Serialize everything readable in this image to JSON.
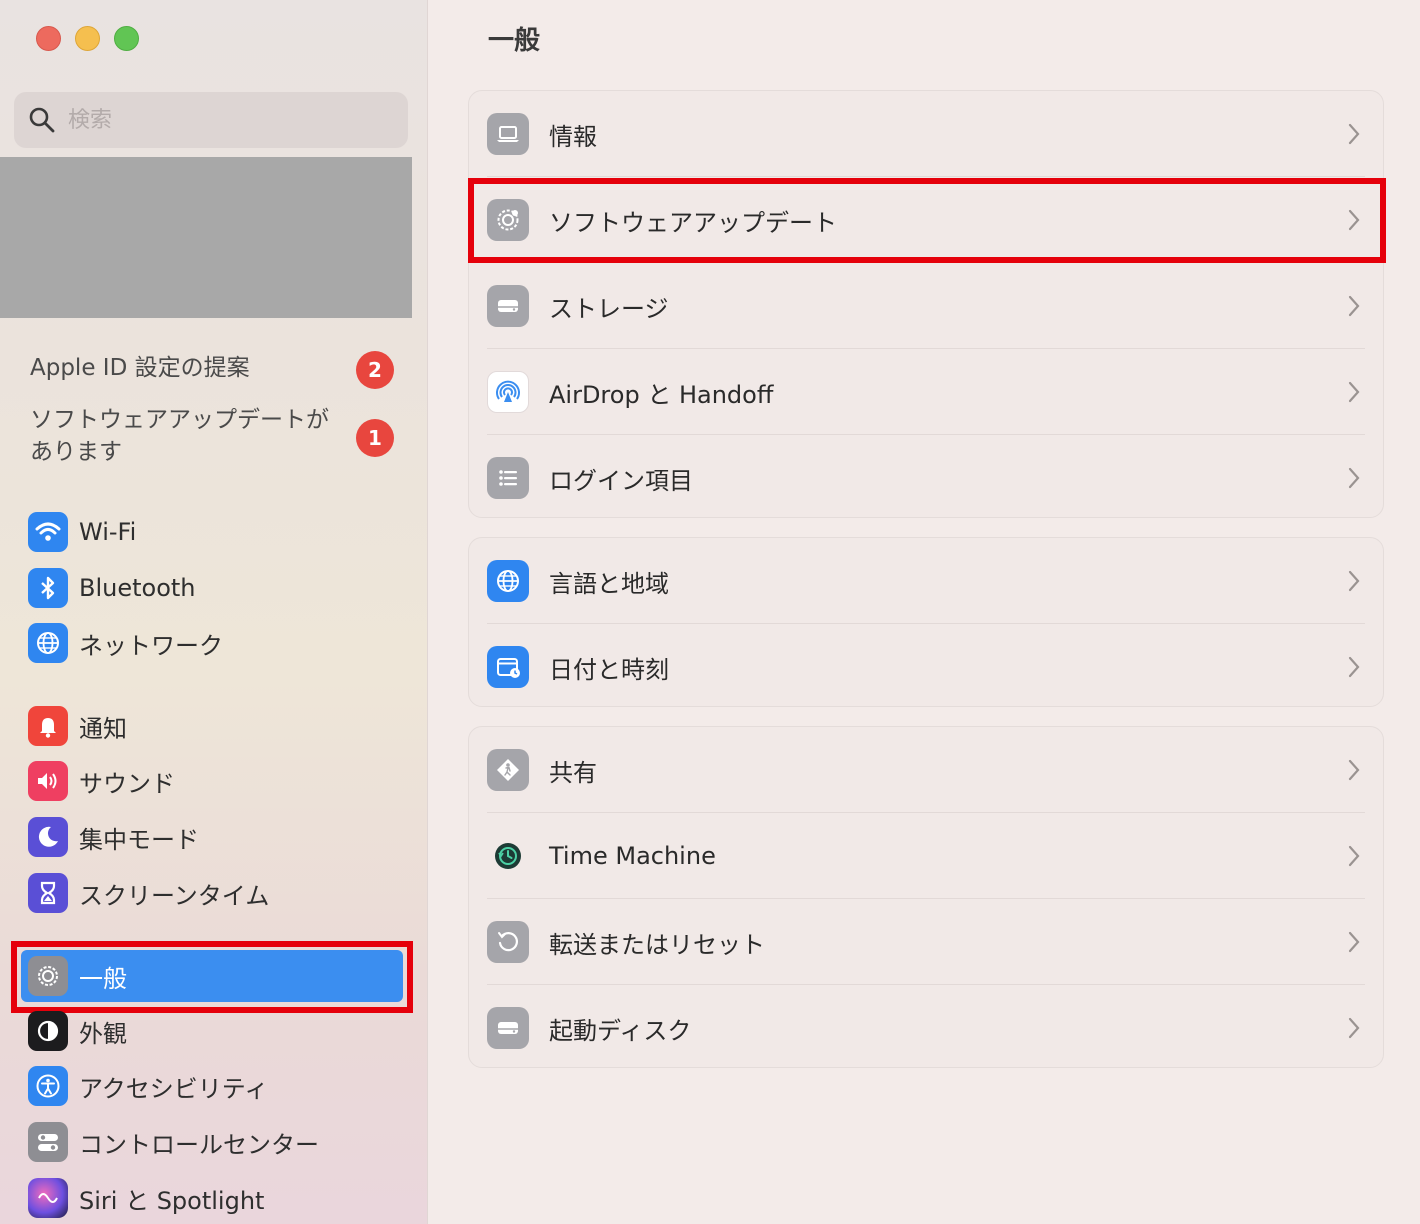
{
  "sidebar": {
    "search_placeholder": "検索",
    "suggestions": [
      {
        "label": "Apple ID 設定の提案",
        "badge": "2"
      },
      {
        "label": "ソフトウェアアップデートがあります",
        "badge": "1"
      }
    ],
    "items": [
      {
        "label": "Wi-Fi",
        "icon": "wifi-icon"
      },
      {
        "label": "Bluetooth",
        "icon": "bluetooth-icon"
      },
      {
        "label": "ネットワーク",
        "icon": "globe-icon"
      },
      {
        "label": "通知",
        "icon": "bell-icon"
      },
      {
        "label": "サウンド",
        "icon": "speaker-icon"
      },
      {
        "label": "集中モード",
        "icon": "moon-icon"
      },
      {
        "label": "スクリーンタイム",
        "icon": "hourglass-icon"
      },
      {
        "label": "一般",
        "icon": "gear-icon",
        "selected": true
      },
      {
        "label": "外観",
        "icon": "appearance-icon"
      },
      {
        "label": "アクセシビリティ",
        "icon": "accessibility-icon"
      },
      {
        "label": "コントロールセンター",
        "icon": "toggles-icon"
      },
      {
        "label": "Siri と Spotlight",
        "icon": "siri-icon"
      }
    ]
  },
  "main": {
    "title": "一般",
    "groups": [
      {
        "rows": [
          {
            "label": "情報",
            "icon": "laptop-icon"
          },
          {
            "label": "ソフトウェアアップデート",
            "icon": "gear-badge-icon",
            "highlighted": true
          },
          {
            "label": "ストレージ",
            "icon": "drive-icon"
          },
          {
            "label": "AirDrop と Handoff",
            "icon": "airdrop-icon"
          },
          {
            "label": "ログイン項目",
            "icon": "list-icon"
          }
        ]
      },
      {
        "rows": [
          {
            "label": "言語と地域",
            "icon": "globe-icon"
          },
          {
            "label": "日付と時刻",
            "icon": "calendar-clock-icon"
          }
        ]
      },
      {
        "rows": [
          {
            "label": "共有",
            "icon": "sharing-icon"
          },
          {
            "label": "Time Machine",
            "icon": "time-machine-icon"
          },
          {
            "label": "転送またはリセット",
            "icon": "reset-icon"
          },
          {
            "label": "起動ディスク",
            "icon": "disk-icon"
          }
        ]
      }
    ]
  },
  "colors": {
    "accent": "#3b8ef0",
    "highlight_box": "#e5000b",
    "badge": "#e8463e"
  }
}
